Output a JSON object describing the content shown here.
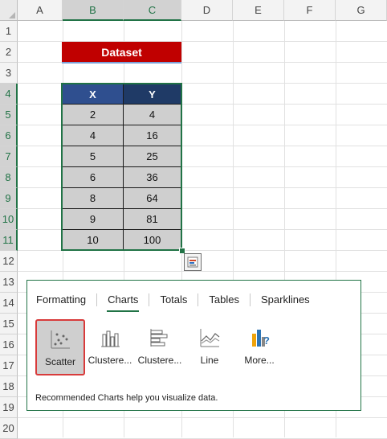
{
  "columns": [
    "A",
    "B",
    "C",
    "D",
    "E",
    "F",
    "G"
  ],
  "rows": [
    "1",
    "2",
    "3",
    "4",
    "5",
    "6",
    "7",
    "8",
    "9",
    "10",
    "11",
    "12",
    "13",
    "14",
    "15",
    "16",
    "17",
    "18",
    "19",
    "20"
  ],
  "dataset_title": "Dataset",
  "table": {
    "headers": [
      "X",
      "Y"
    ],
    "rows": [
      [
        "2",
        "4"
      ],
      [
        "4",
        "16"
      ],
      [
        "5",
        "25"
      ],
      [
        "6",
        "36"
      ],
      [
        "8",
        "64"
      ],
      [
        "9",
        "81"
      ],
      [
        "10",
        "100"
      ]
    ]
  },
  "quick_analysis": {
    "button_icon": "quick-analysis-icon",
    "tabs": [
      "Formatting",
      "Charts",
      "Totals",
      "Tables",
      "Sparklines"
    ],
    "active_tab": "Charts",
    "items": [
      {
        "label": "Scatter",
        "icon": "scatter-chart-icon",
        "selected": true
      },
      {
        "label": "Clustere...",
        "icon": "clustered-column-icon",
        "selected": false
      },
      {
        "label": "Clustere...",
        "icon": "clustered-bar-icon",
        "selected": false
      },
      {
        "label": "Line",
        "icon": "line-chart-icon",
        "selected": false
      },
      {
        "label": "More...",
        "icon": "more-charts-icon",
        "selected": false
      }
    ],
    "hint": "Recommended Charts help you visualize data."
  },
  "colors": {
    "selection": "#217346",
    "title_fill": "#c00000",
    "header_fill": "#2f4f8f",
    "body_fill": "#cfcfcf",
    "selected_item_border": "#d83b3b"
  }
}
